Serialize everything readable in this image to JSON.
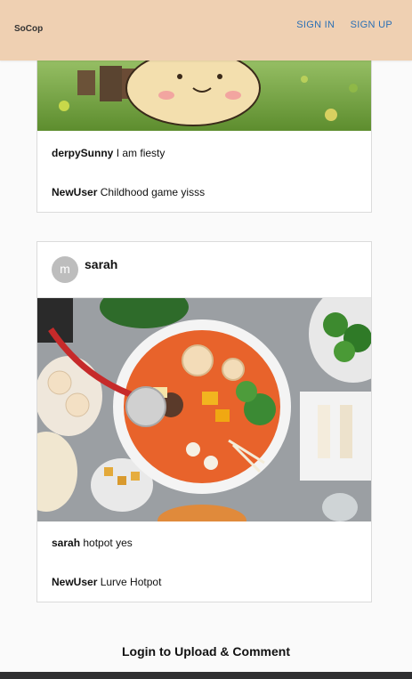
{
  "header": {
    "logo": "SoCop",
    "sign_in": "SIGN IN",
    "sign_up": "SIGN UP"
  },
  "posts": [
    {
      "comments": [
        {
          "user": "derpySunny",
          "text": "I am fiesty"
        },
        {
          "user": "NewUser",
          "text": "Childhood game yisss"
        }
      ]
    },
    {
      "author_initial": "m",
      "author": "sarah",
      "comments": [
        {
          "user": "sarah",
          "text": "hotpot yes"
        },
        {
          "user": "NewUser",
          "text": "Lurve Hotpot"
        }
      ]
    }
  ],
  "footer": {
    "cta": "Login to Upload & Comment"
  }
}
